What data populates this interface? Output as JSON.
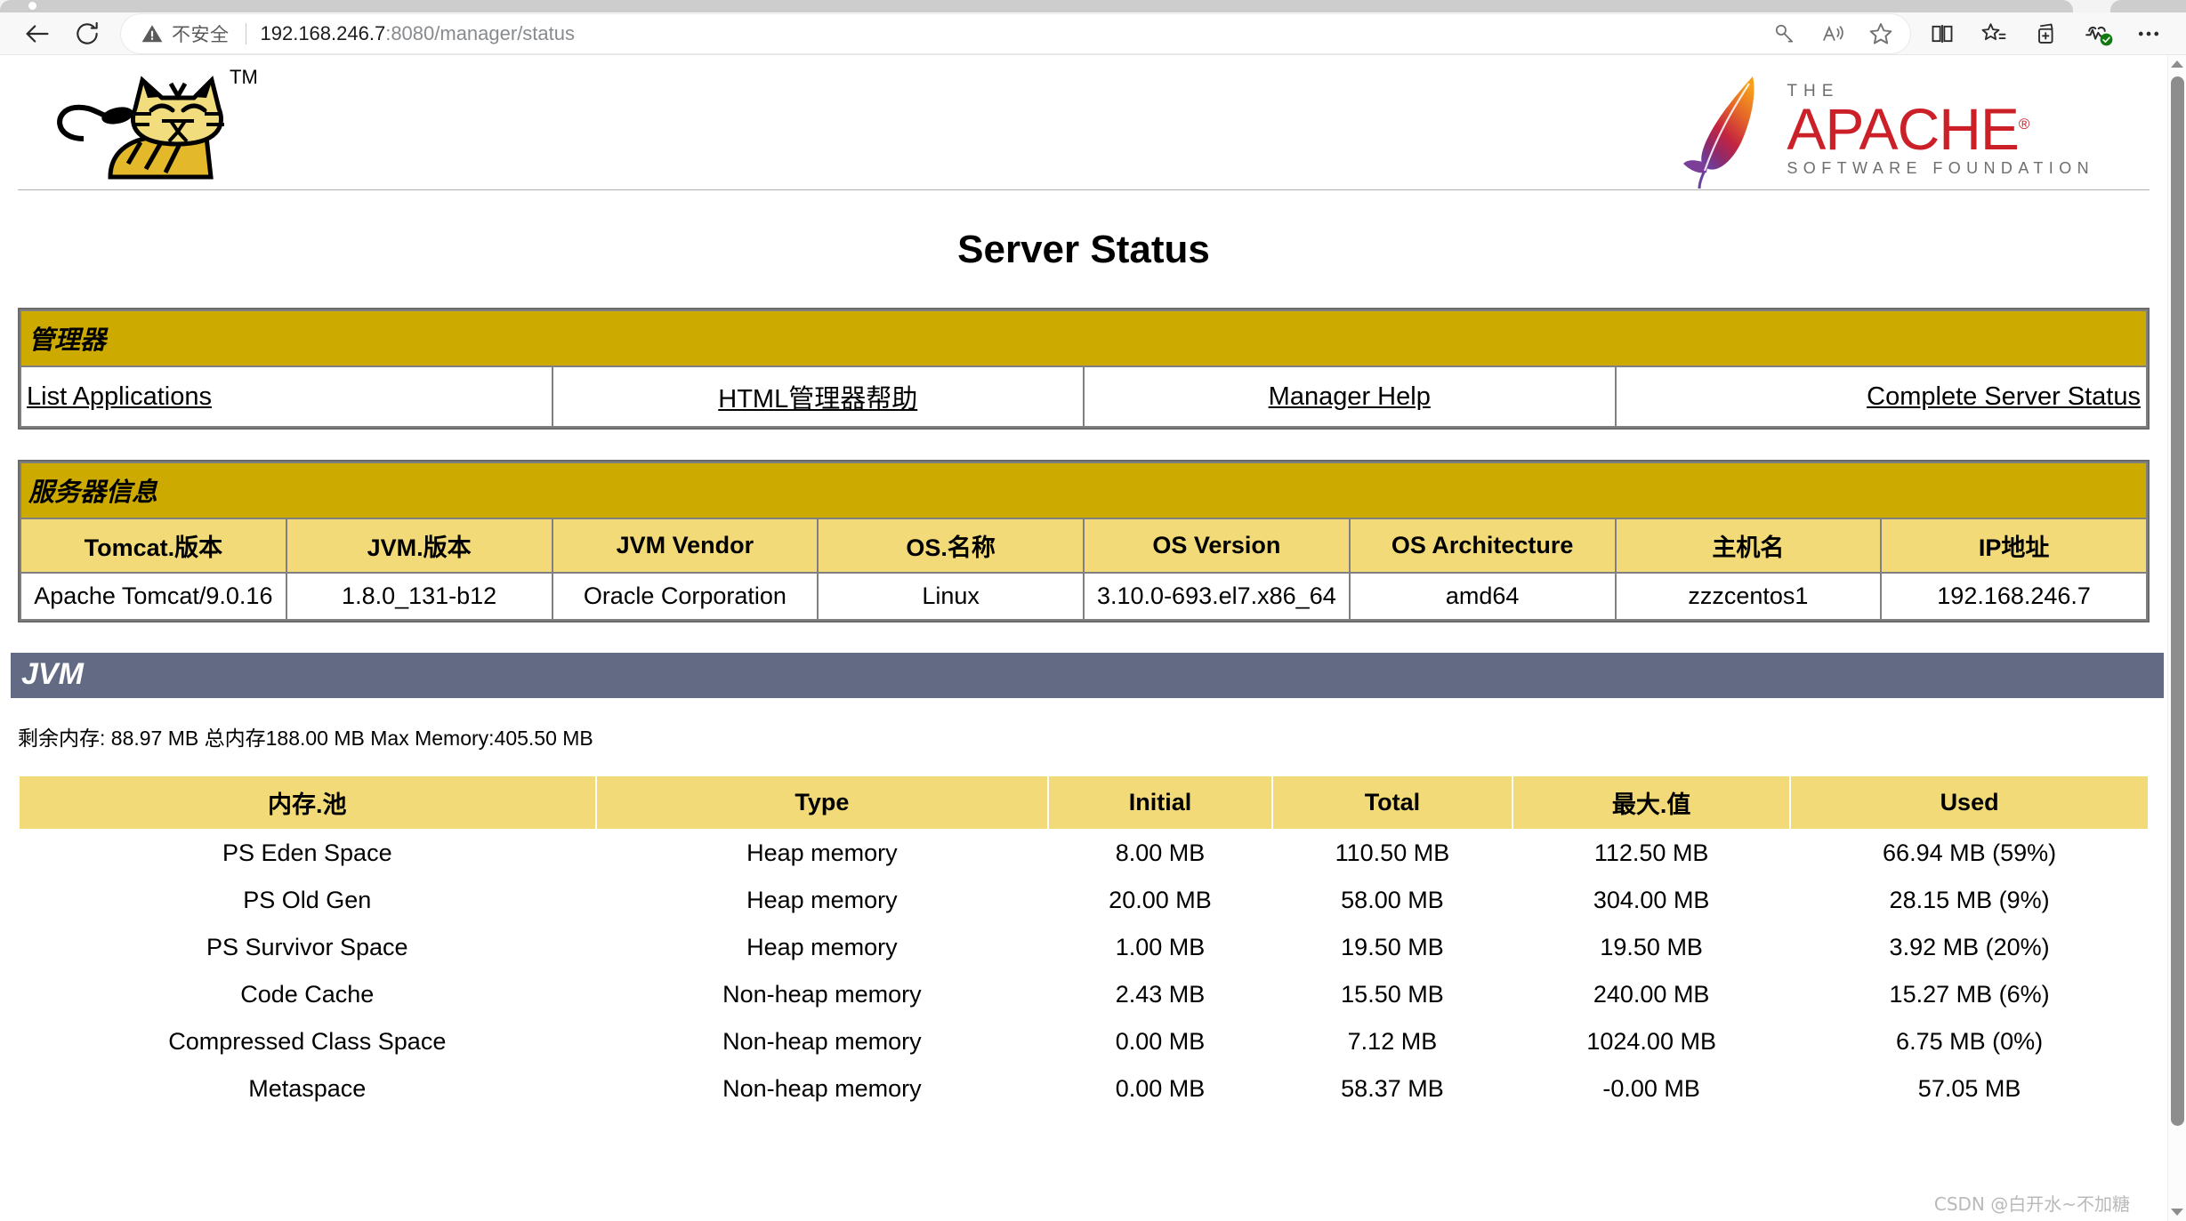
{
  "browser": {
    "back_label": "Back",
    "reload_label": "Reload",
    "security_label": "不安全",
    "url_host": "192.168.246.7",
    "url_path": ":8080/manager/status",
    "omnibox_icons": [
      "key-icon",
      "read-aloud-icon",
      "favorite-star-icon"
    ],
    "toolbar_icons": [
      "split-screen-icon",
      "favorites-list-icon",
      "collections-icon",
      "browser-essentials-icon",
      "settings-more-icon"
    ]
  },
  "branding": {
    "tomcat_logo_alt": "Apache Tomcat cat logo",
    "tomcat_tm": "TM",
    "apache_the": "THE",
    "apache_name": "APACHE",
    "apache_reg": "®",
    "apache_sub": "SOFTWARE FOUNDATION"
  },
  "page": {
    "title": "Server Status",
    "watermark": "CSDN @白开水~不加糖"
  },
  "manager": {
    "section_title": "管理器",
    "links": [
      {
        "label": "List Applications",
        "align": "left"
      },
      {
        "label": "HTML管理器帮助",
        "align": "center"
      },
      {
        "label": "Manager Help",
        "align": "center"
      },
      {
        "label": "Complete Server Status",
        "align": "right"
      }
    ]
  },
  "server_info": {
    "section_title": "服务器信息",
    "headers": [
      "Tomcat.版本",
      "JVM.版本",
      "JVM Vendor",
      "OS.名称",
      "OS Version",
      "OS Architecture",
      "主机名",
      "IP地址"
    ],
    "values": [
      "Apache Tomcat/9.0.16",
      "1.8.0_131-b12",
      "Oracle Corporation",
      "Linux",
      "3.10.0-693.el7.x86_64",
      "amd64",
      "zzzcentos1",
      "192.168.246.7"
    ]
  },
  "jvm": {
    "section_title": "JVM",
    "memory_summary": "剩余内存: 88.97 MB 总内存188.00 MB Max Memory:405.50 MB",
    "headers": [
      "内存.池",
      "Type",
      "Initial",
      "Total",
      "最大.值",
      "Used"
    ],
    "rows": [
      [
        "PS Eden Space",
        "Heap memory",
        "8.00 MB",
        "110.50 MB",
        "112.50 MB",
        "66.94 MB (59%)"
      ],
      [
        "PS Old Gen",
        "Heap memory",
        "20.00 MB",
        "58.00 MB",
        "304.00 MB",
        "28.15 MB (9%)"
      ],
      [
        "PS Survivor Space",
        "Heap memory",
        "1.00 MB",
        "19.50 MB",
        "19.50 MB",
        "3.92 MB (20%)"
      ],
      [
        "Code Cache",
        "Non-heap memory",
        "2.43 MB",
        "15.50 MB",
        "240.00 MB",
        "15.27 MB (6%)"
      ],
      [
        "Compressed Class Space",
        "Non-heap memory",
        "0.00 MB",
        "7.12 MB",
        "1024.00 MB",
        "6.75 MB (0%)"
      ],
      [
        "Metaspace",
        "Non-heap memory",
        "0.00 MB",
        "58.37 MB",
        "-0.00 MB",
        "57.05 MB"
      ]
    ]
  },
  "colors": {
    "gold_header": "#ccaa00",
    "table_header": "#f2da79",
    "jvm_band": "#626a84",
    "apache_red": "#cb2027",
    "tomcat_yellow": "#e3b82a"
  }
}
